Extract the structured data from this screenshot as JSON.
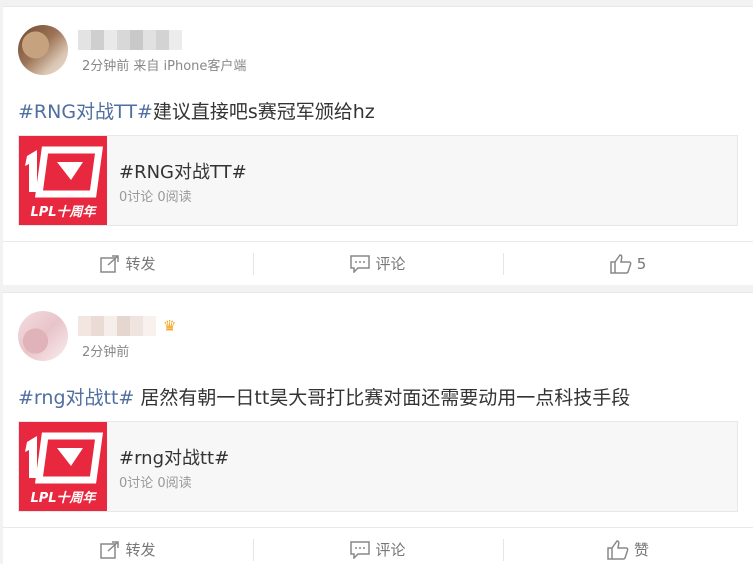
{
  "posts": [
    {
      "username": "",
      "meta": "2分钟前 来自 iPhone客户端",
      "hashtag": "#RNG对战TT#",
      "body": "建议直接吧s赛冠军颁给hz",
      "topic": {
        "title": "#RNG对战TT#",
        "stats": "0讨论 0阅读",
        "logo_text": "LPL十周年"
      },
      "actions": {
        "repost": "转发",
        "comment": "评论",
        "like": "5"
      }
    },
    {
      "username": "",
      "meta": "2分钟前",
      "hashtag": "#rng对战tt#",
      "body": " 居然有朝一日tt昊大哥打比赛对面还需要动用一点科技手段",
      "topic": {
        "title": "#rng对战tt#",
        "stats": "0讨论 0阅读",
        "logo_text": "LPL十周年"
      },
      "actions": {
        "repost": "转发",
        "comment": "评论",
        "like": "赞"
      }
    }
  ],
  "colors": {
    "hashtag": "#4f6fa0",
    "logo_bg": "#e8283e",
    "muted": "#888888"
  },
  "icons": [
    "repost-icon",
    "comment-icon",
    "like-icon",
    "crown-icon"
  ]
}
